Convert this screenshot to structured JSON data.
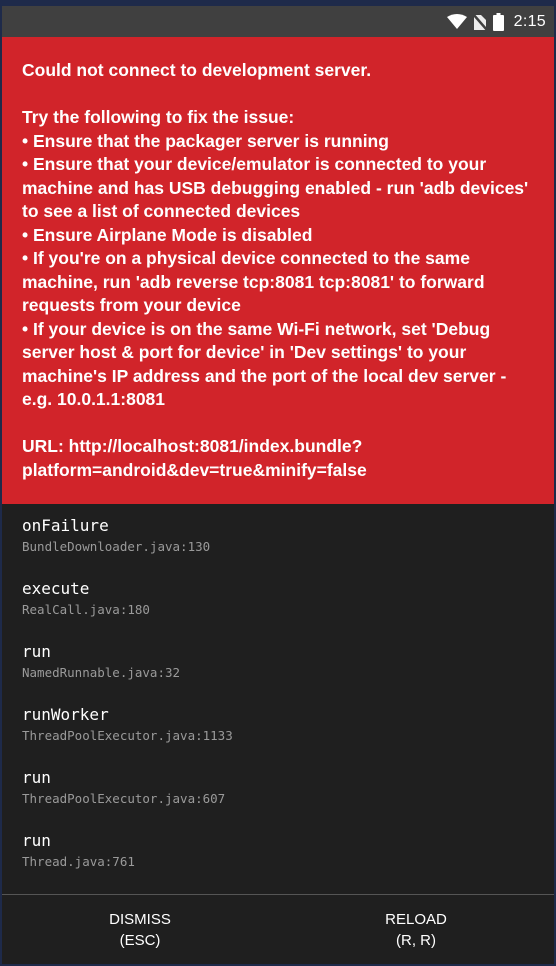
{
  "status_bar": {
    "time": "2:15",
    "icons": [
      "wifi-icon",
      "no-sim-icon",
      "battery-icon"
    ]
  },
  "redbox": {
    "title": "Could not connect to development server.",
    "instructions_heading": "Try the following to fix the issue:",
    "tips": [
      "• Ensure that the packager server is running",
      "• Ensure that your device/emulator is connected to your machine and has USB debugging enabled - run 'adb devices' to see a list of connected devices",
      "• Ensure Airplane Mode is disabled",
      "• If you're on a physical device connected to the same machine, run 'adb reverse tcp:8081 tcp:8081' to forward requests from your device",
      "• If your device is on the same Wi-Fi network, set 'Debug server host & port for device' in 'Dev settings' to your machine's IP address and the port of the local dev server - e.g. 10.0.1.1:8081"
    ],
    "url": "URL: http://localhost:8081/index.bundle?platform=android&dev=true&minify=false"
  },
  "stack_trace": [
    {
      "method": "onFailure",
      "location": "BundleDownloader.java:130"
    },
    {
      "method": "execute",
      "location": "RealCall.java:180"
    },
    {
      "method": "run",
      "location": "NamedRunnable.java:32"
    },
    {
      "method": "runWorker",
      "location": "ThreadPoolExecutor.java:1133"
    },
    {
      "method": "run",
      "location": "ThreadPoolExecutor.java:607"
    },
    {
      "method": "run",
      "location": "Thread.java:761"
    }
  ],
  "footer": {
    "dismiss_label": "DISMISS",
    "dismiss_shortcut": "(ESC)",
    "reload_label": "RELOAD",
    "reload_shortcut": "(R, R)"
  },
  "colors": {
    "redbox_bg": "#d1242a",
    "screen_bg": "#1f1f1f",
    "statusbar_bg": "#404040",
    "location_text": "#9a9a9a"
  }
}
